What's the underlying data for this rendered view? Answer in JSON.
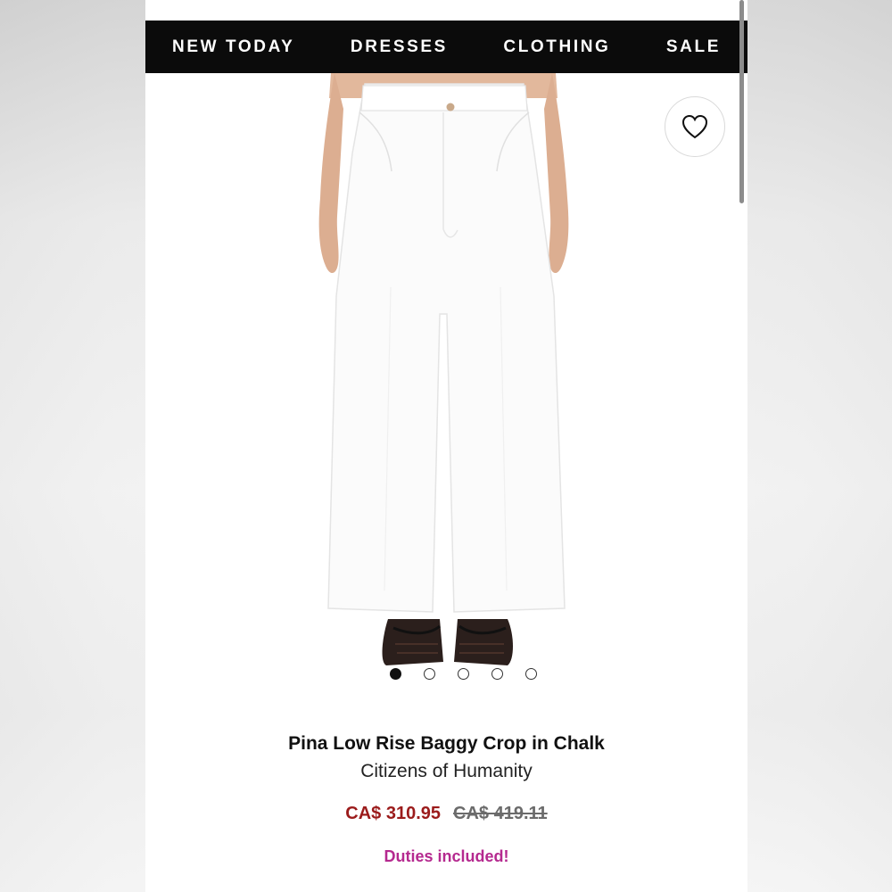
{
  "nav": {
    "items": [
      {
        "label": "NEW TODAY"
      },
      {
        "label": "DRESSES"
      },
      {
        "label": "CLOTHING"
      },
      {
        "label": "SALE"
      }
    ]
  },
  "product": {
    "image_icon": "white-wide-leg-jeans-photo",
    "wishlist_icon": "heart-icon",
    "title": "Pina Low Rise Baggy Crop in Chalk",
    "brand": "Citizens of Humanity",
    "sale_price": "CA$ 310.95",
    "original_price": "CA$ 419.11",
    "duties_note": "Duties included!"
  },
  "carousel": {
    "count": 5,
    "active_index": 0
  },
  "colors": {
    "nav_bg": "#0b0b0b",
    "sale_price": "#9b1b1b",
    "duties": "#b5298f"
  }
}
